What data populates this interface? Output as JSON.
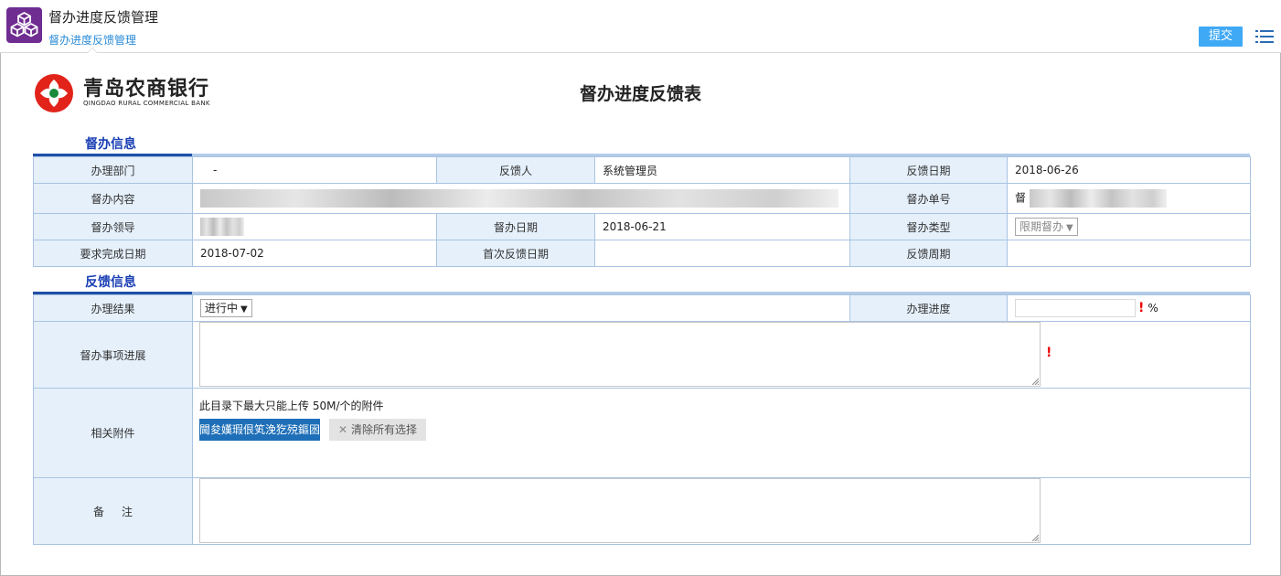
{
  "app": {
    "title": "督办进度反馈管理",
    "subtitle": "督办进度反馈管理",
    "submit_label": "提交"
  },
  "logo": {
    "name": "青岛农商银行",
    "english": "QINGDAO RURAL COMMERCIAL BANK"
  },
  "form": {
    "title": "督办进度反馈表"
  },
  "supervision_section": {
    "title": "督办信息",
    "rows": [
      [
        {
          "label": "办理部门",
          "value": "-"
        },
        {
          "label": "反馈人",
          "value": "系统管理员"
        },
        {
          "label": "反馈日期",
          "value": "2018-06-26"
        }
      ],
      [
        {
          "label": "督办内容",
          "value": ""
        },
        {
          "label": "督办单号",
          "value": "督"
        }
      ],
      [
        {
          "label": "督办领导",
          "value": ""
        },
        {
          "label": "督办日期",
          "value": "2018-06-21"
        },
        {
          "label": "督办类型",
          "value": "限期督办"
        }
      ],
      [
        {
          "label": "要求完成日期",
          "value": "2018-07-02"
        },
        {
          "label": "首次反馈日期",
          "value": ""
        },
        {
          "label": "反馈周期",
          "value": ""
        }
      ]
    ]
  },
  "feedback_section": {
    "title": "反馈信息",
    "result_label": "办理结果",
    "result_value": "进行中",
    "progress_label": "办理进度",
    "progress_value": "",
    "progress_unit": "%",
    "progress_required": "!",
    "progress_text_label": "督办事项进展",
    "progress_text_required": "!",
    "attachment_label": "相关附件",
    "attachment_hint": "此目录下最大只能上传 50M/个的附件",
    "upload_label": "閫夋嫨瑕佷笂浼犵殑鏂囦欢",
    "clear_label": "清除所有选择",
    "remark_label": "备     注"
  },
  "colors": {
    "brand_purple": "#6f2c91",
    "submit_blue": "#3fa9f5",
    "section_title": "#1a3fb5",
    "label_bg": "#e5f0fb",
    "upload_blue": "#1e6fb8",
    "required_red": "#ee0000"
  },
  "icons": {
    "app": "cube-stack-icon",
    "menu": "list-menu-icon",
    "clear": "close-icon",
    "logo": "qdrcb-logo-icon"
  }
}
